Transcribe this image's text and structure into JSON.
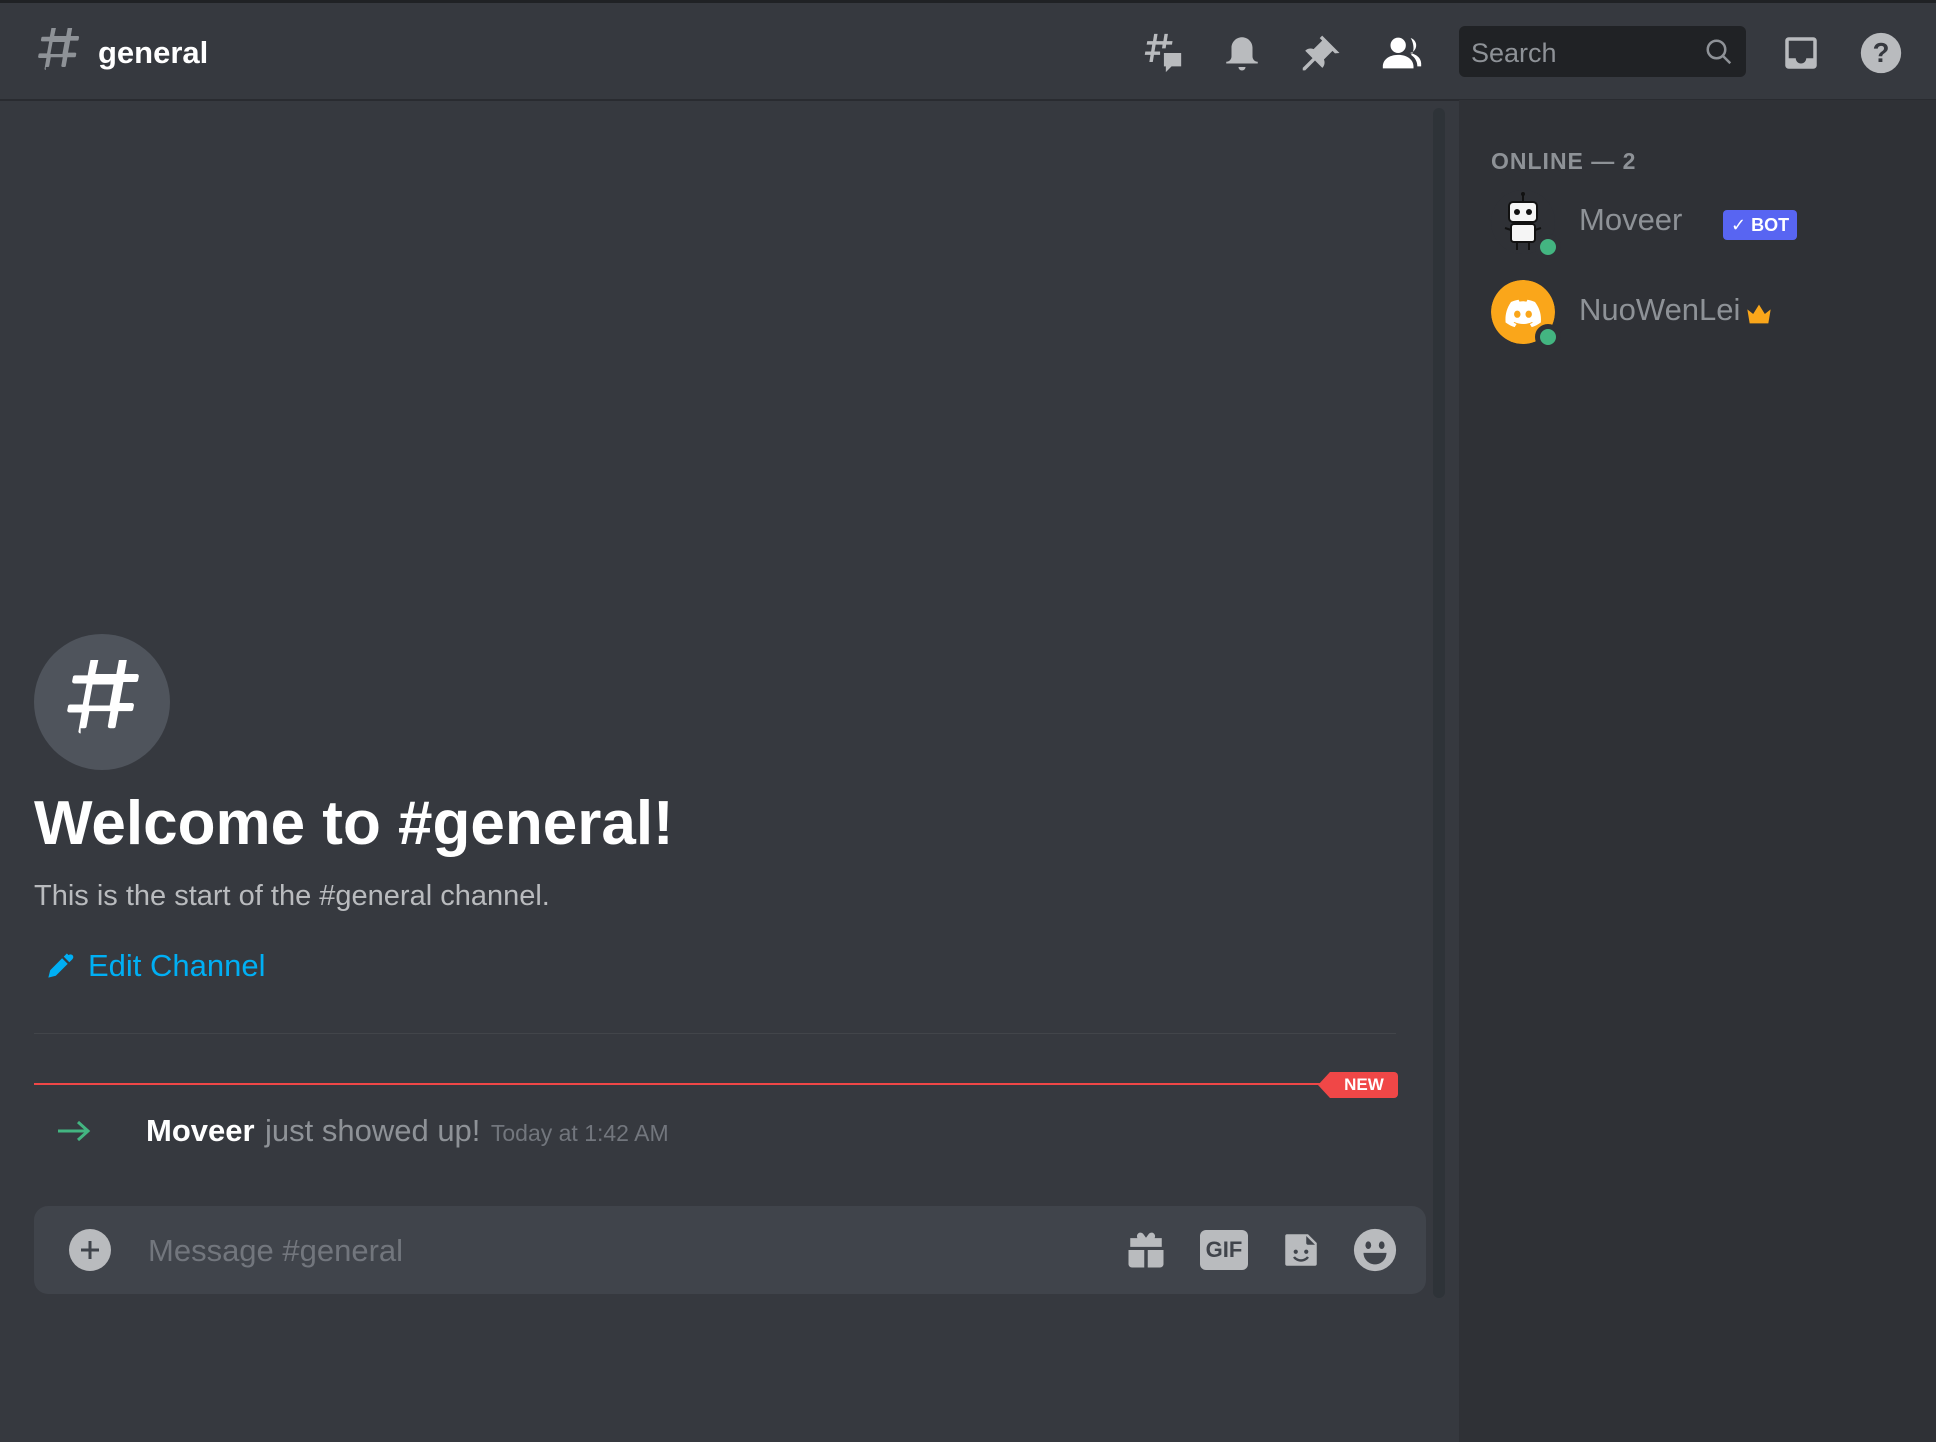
{
  "header": {
    "channel_name": "general",
    "search_placeholder": "Search"
  },
  "welcome": {
    "title": "Welcome to #general!",
    "subtitle": "This is the start of the #general channel.",
    "edit_channel_label": "Edit Channel"
  },
  "new_divider": {
    "badge": "NEW"
  },
  "messages": [
    {
      "user": "Moveer",
      "text": "just showed up!",
      "timestamp": "Today at 1:42 AM"
    }
  ],
  "composer": {
    "placeholder": "Message #general",
    "gif_label": "GIF"
  },
  "members": {
    "header": "ONLINE — 2",
    "list": [
      {
        "name": "Moveer",
        "badge": "✓ BOT",
        "status": "online"
      },
      {
        "name": "NuoWenLei",
        "badge_icon": "crown-icon",
        "status": "online"
      }
    ]
  },
  "colors": {
    "background": "#36393f",
    "sidebar": "#2f3136",
    "link": "#00aff4",
    "new_red": "#f04747",
    "online_green": "#43b581",
    "bot_badge": "#5865f2",
    "crown": "#faa61a"
  }
}
